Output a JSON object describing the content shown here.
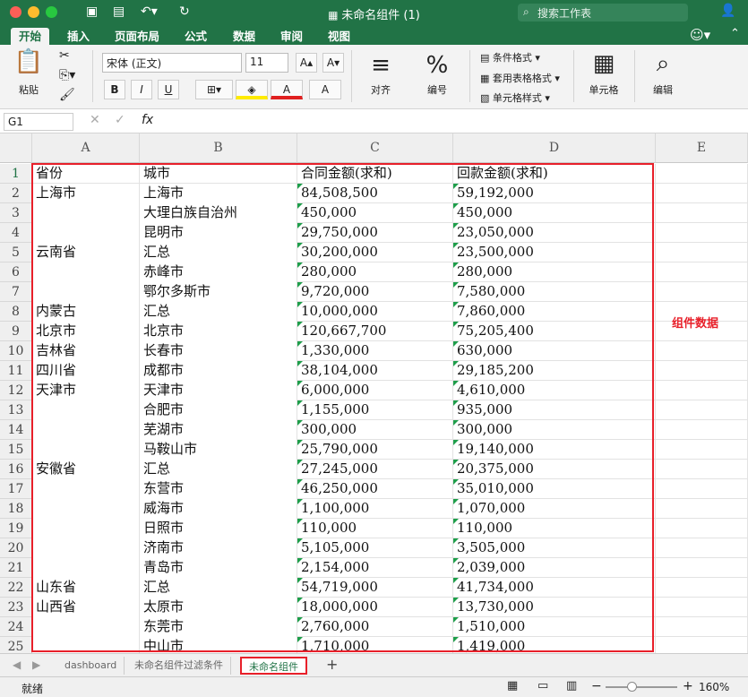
{
  "window": {
    "title": "未命名组件 (1)",
    "search_placeholder": "搜索工作表"
  },
  "tabs": [
    "开始",
    "插入",
    "页面布局",
    "公式",
    "数据",
    "审阅",
    "视图"
  ],
  "ribbon": {
    "paste": "粘贴",
    "font_name": "宋体 (正文)",
    "font_size": "11",
    "bold": "B",
    "italic": "I",
    "underline": "U",
    "align": "对齐",
    "number": "编号",
    "cond_format": "条件格式",
    "table_format": "套用表格格式",
    "cell_style": "单元格样式",
    "cells": "单元格",
    "edit": "编辑"
  },
  "formula_bar": {
    "name_box": "G1",
    "fx": "fx",
    "value": ""
  },
  "columns": [
    "A",
    "B",
    "C",
    "D",
    "E"
  ],
  "rows": [
    {
      "n": "1",
      "a": "省份",
      "b": "城市",
      "c": "合同金额(求和)",
      "d": "回款金额(求和)"
    },
    {
      "n": "2",
      "a": "上海市",
      "b": "上海市",
      "c": "84,508,500",
      "d": "59,192,000"
    },
    {
      "n": "3",
      "a": "",
      "b": "大理白族自治州",
      "c": "450,000",
      "d": "450,000"
    },
    {
      "n": "4",
      "a": "",
      "b": "昆明市",
      "c": "29,750,000",
      "d": "23,050,000"
    },
    {
      "n": "5",
      "a": "云南省",
      "b": "汇总",
      "c": "30,200,000",
      "d": "23,500,000"
    },
    {
      "n": "6",
      "a": "",
      "b": "赤峰市",
      "c": "280,000",
      "d": "280,000"
    },
    {
      "n": "7",
      "a": "",
      "b": "鄂尔多斯市",
      "c": "9,720,000",
      "d": "7,580,000"
    },
    {
      "n": "8",
      "a": "内蒙古",
      "b": "汇总",
      "c": "10,000,000",
      "d": "7,860,000"
    },
    {
      "n": "9",
      "a": "北京市",
      "b": "北京市",
      "c": "120,667,700",
      "d": "75,205,400"
    },
    {
      "n": "10",
      "a": "吉林省",
      "b": "长春市",
      "c": "1,330,000",
      "d": "630,000"
    },
    {
      "n": "11",
      "a": "四川省",
      "b": "成都市",
      "c": "38,104,000",
      "d": "29,185,200"
    },
    {
      "n": "12",
      "a": "天津市",
      "b": "天津市",
      "c": "6,000,000",
      "d": "4,610,000"
    },
    {
      "n": "13",
      "a": "",
      "b": "合肥市",
      "c": "1,155,000",
      "d": "935,000"
    },
    {
      "n": "14",
      "a": "",
      "b": "芜湖市",
      "c": "300,000",
      "d": "300,000"
    },
    {
      "n": "15",
      "a": "",
      "b": "马鞍山市",
      "c": "25,790,000",
      "d": "19,140,000"
    },
    {
      "n": "16",
      "a": "安徽省",
      "b": "汇总",
      "c": "27,245,000",
      "d": "20,375,000"
    },
    {
      "n": "17",
      "a": "",
      "b": "东营市",
      "c": "46,250,000",
      "d": "35,010,000"
    },
    {
      "n": "18",
      "a": "",
      "b": "威海市",
      "c": "1,100,000",
      "d": "1,070,000"
    },
    {
      "n": "19",
      "a": "",
      "b": "日照市",
      "c": "110,000",
      "d": "110,000"
    },
    {
      "n": "20",
      "a": "",
      "b": "济南市",
      "c": "5,105,000",
      "d": "3,505,000"
    },
    {
      "n": "21",
      "a": "",
      "b": "青岛市",
      "c": "2,154,000",
      "d": "2,039,000"
    },
    {
      "n": "22",
      "a": "山东省",
      "b": "汇总",
      "c": "54,719,000",
      "d": "41,734,000"
    },
    {
      "n": "23",
      "a": "山西省",
      "b": "太原市",
      "c": "18,000,000",
      "d": "13,730,000"
    },
    {
      "n": "24",
      "a": "",
      "b": "东莞市",
      "c": "2,760,000",
      "d": "1,510,000"
    },
    {
      "n": "25",
      "a": "",
      "b": "中山市",
      "c": "1,710,000",
      "d": "1,419,000"
    }
  ],
  "annotation": "组件数据",
  "sheet_tabs": [
    "dashboard",
    "未命名组件过滤条件",
    "未命名组件"
  ],
  "status": {
    "ready": "就绪",
    "zoom": "160%"
  },
  "colors": {
    "excel_green": "#217346",
    "highlight_red": "#e8202a"
  }
}
